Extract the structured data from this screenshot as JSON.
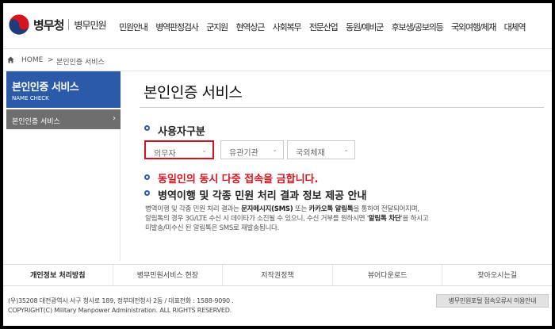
{
  "header": {
    "logo_main": "병무청",
    "logo_sub": "병무민원",
    "nav": [
      "민원안내",
      "병역판정검사",
      "군지원",
      "현역상근",
      "사회복무",
      "전문산업",
      "동원/예비군",
      "후보생/공보의등",
      "국외여행/체재",
      "대체역"
    ]
  },
  "breadcrumb": {
    "home": "HOME",
    "separator": ">",
    "current": "본인인증 서비스"
  },
  "sidebar": {
    "title": "본인인증 서비스",
    "subtitle": "NAME CHECK",
    "item": "본인인증 서비스",
    "item_chevron": "›"
  },
  "main": {
    "title": "본인인증 서비스",
    "section1": "사용자구분",
    "selects": [
      {
        "value": "의무자"
      },
      {
        "value": "유관기관"
      },
      {
        "value": "국외체재"
      }
    ],
    "warning": "동일인의 동시 다중 접속을 금합니다.",
    "section2": "병역이행 및 각종 민원 처리 결과 정보 제공 안내",
    "desc": {
      "l1_a": "병역이행 및 각종 민원 처리 결과는 ",
      "l1_b": "문자메시지(SMS)",
      "l1_c": " 또는 ",
      "l1_d": "카카오톡 알림톡",
      "l1_e": "을 통하여 전달되어지며,",
      "l2_a": "알림톡의 경우 3G/LTE 수신 시 데이타가 소진될 수 있으니, 수신 거부를 원하시면 '",
      "l2_b": "알림톡 차단",
      "l2_c": "'을 하시고",
      "l3": "미발송/미수신 된 알림톡은 SMS로 재발송됩니다."
    }
  },
  "footer": {
    "links": [
      "개인정보 처리방침",
      "병무민원서비스 현장",
      "저작권정책",
      "뷰어다운로드",
      "찾아오시는길"
    ],
    "address": "(우)35208 대전광역시 서구 청사로 189, 정부대전청사 2동 / 대표전화 : 1588-9090 .",
    "copyright": "COPYRIGHT(C) Military Manpower Administration. ALL RIGHTS RESERVED.",
    "report_button": "병무민원포털 접속오류시 이용안내"
  },
  "colors": {
    "brand_blue": "#2b5ba8",
    "warning_red": "#d4141e",
    "sidebar_gray": "#6e6e6e"
  }
}
